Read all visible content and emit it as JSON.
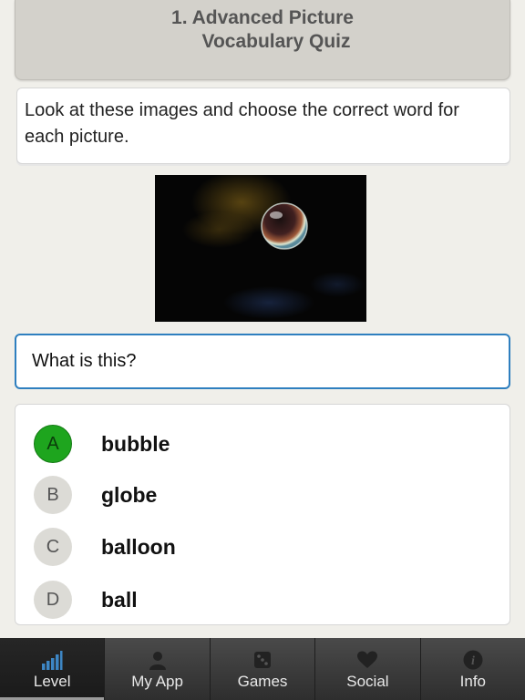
{
  "header": {
    "title_line1": "1. Advanced Picture",
    "title_line2": "Vocabulary Quiz"
  },
  "instructions": {
    "text": "Look at these images and choose the correct word for each picture."
  },
  "question": {
    "text": "What is this?"
  },
  "options": [
    {
      "letter": "A",
      "word": "bubble",
      "selected": true
    },
    {
      "letter": "B",
      "word": "globe",
      "selected": false
    },
    {
      "letter": "C",
      "word": "balloon",
      "selected": false
    },
    {
      "letter": "D",
      "word": "ball",
      "selected": false
    }
  ],
  "tabbar": {
    "tabs": [
      {
        "label": "Level",
        "icon": "signal-bars-icon",
        "active": true
      },
      {
        "label": "My App",
        "icon": "person-icon",
        "active": false
      },
      {
        "label": "Games",
        "icon": "dice-icon",
        "active": false
      },
      {
        "label": "Social",
        "icon": "heart-icon",
        "active": false
      },
      {
        "label": "Info",
        "icon": "info-icon",
        "active": false
      }
    ]
  },
  "colors": {
    "selected_option": "#1ea51e",
    "question_border": "#2e7fbf",
    "tabbar": "#3a3a3a"
  }
}
